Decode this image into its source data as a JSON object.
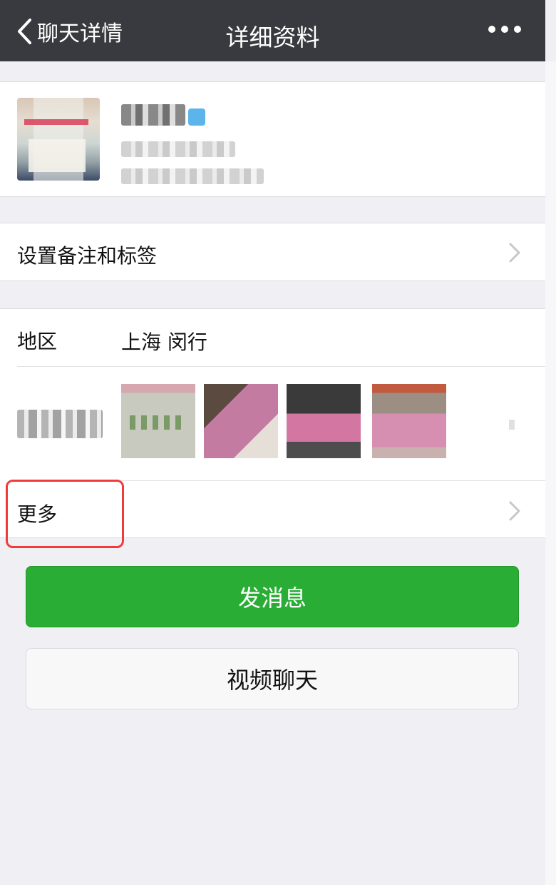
{
  "navbar": {
    "back_label": "聊天详情",
    "title": "详细资料",
    "more_icon": "more-dots-icon"
  },
  "profile": {
    "avatar": "avatar-image",
    "verified_badge_color": "#3ea8e8"
  },
  "remark_row": {
    "label": "设置备注和标签"
  },
  "info": {
    "region_label": "地区",
    "region_value": "上海 闵行",
    "more_label": "更多"
  },
  "buttons": {
    "send_message": "发消息",
    "video_chat": "视频聊天"
  },
  "colors": {
    "navbar_bg": "#393a3f",
    "primary_green": "#2aad34",
    "highlight_red": "#f13b3b",
    "page_bg": "#efeff4"
  }
}
